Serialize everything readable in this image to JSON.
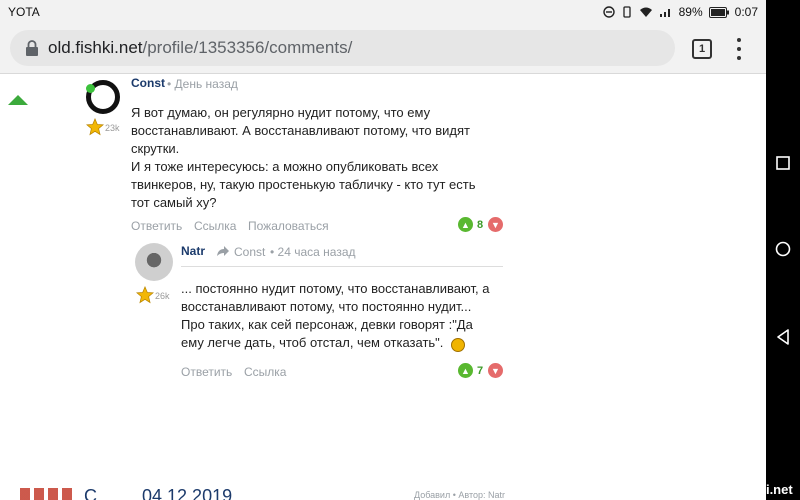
{
  "status_bar": {
    "carrier": "YOTA",
    "battery": "89%",
    "time": "0:07"
  },
  "browser": {
    "url_domain": "old.fishki.net",
    "url_path": "/profile/1353356/comments/",
    "tab_count": "1"
  },
  "comments": [
    {
      "author": "Const",
      "meta": "• День назад",
      "rating": "23k",
      "text": [
        "Я вот думаю, он регулярно нудит потому, что ему",
        "восстанавливают. А восстанавливают потому, что видят",
        "скрутки.",
        "И я тоже интересуюсь: а можно опубликовать всех",
        "твинкеров, ну, такую простенькую табличку - кто тут есть",
        "тот самый ху?"
      ],
      "actions": [
        "Ответить",
        "Ссылка",
        "Пожаловаться"
      ],
      "votes": "8"
    },
    {
      "author": "Natr",
      "reply_to": "Const",
      "meta": "• 24 часа назад",
      "rating": "26k",
      "text": [
        "... постоянно нудит потому, что восстанавливают, а",
        "восстанавливают потому, что постоянно нудит...",
        "Про таких, как сей персонаж, девки говорят :\"Да",
        "ему легче дать, чтоб отстал, чем отказать\"."
      ],
      "actions": [
        "Ответить",
        "Ссылка"
      ],
      "votes": "7"
    }
  ],
  "bottom_post": {
    "title": "С........ 04.12.2019",
    "meta": "Добавил • Автор: Natr"
  },
  "watermark": "Fishki.net",
  "colors": {
    "author": "#1b3a6b",
    "vote_up": "#59b830",
    "vote_down": "#e56b6b",
    "meta_gray": "#9aa0a6"
  }
}
